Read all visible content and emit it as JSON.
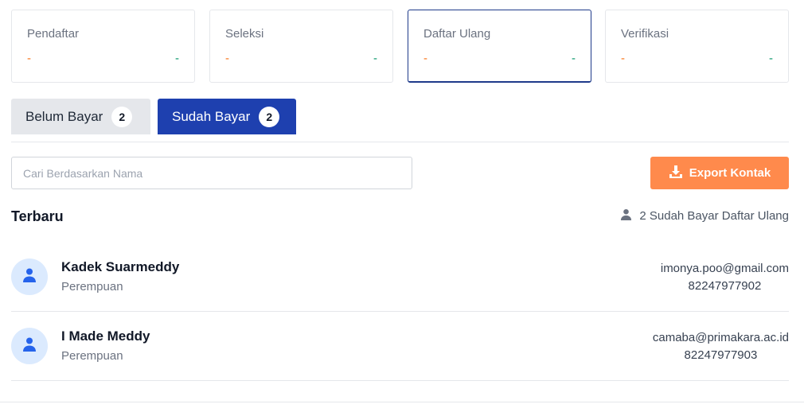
{
  "stats": [
    {
      "title": "Pendaftar",
      "left": "-",
      "right": "-"
    },
    {
      "title": "Seleksi",
      "left": "-",
      "right": "-"
    },
    {
      "title": "Daftar Ulang",
      "left": "-",
      "right": "-"
    },
    {
      "title": "Verifikasi",
      "left": "-",
      "right": "-"
    }
  ],
  "tabs": [
    {
      "label": "Belum Bayar",
      "count": "2"
    },
    {
      "label": "Sudah Bayar",
      "count": "2"
    }
  ],
  "search": {
    "placeholder": "Cari Berdasarkan Nama"
  },
  "export": {
    "label": "Export Kontak"
  },
  "section": {
    "title": "Terbaru",
    "summary": "2 Sudah Bayar Daftar Ulang"
  },
  "students": [
    {
      "name": "Kadek Suarmeddy",
      "gender": "Perempuan",
      "email": "imonya.poo@gmail.com",
      "phone": "82247977902"
    },
    {
      "name": "I Made Meddy",
      "gender": "Perempuan",
      "email": "camaba@primakara.ac.id",
      "phone": "82247977903"
    }
  ],
  "colors": {
    "primary": "#1e40af",
    "accent": "#ff8a4c",
    "positive": "#059669",
    "negative": "#f97316"
  }
}
